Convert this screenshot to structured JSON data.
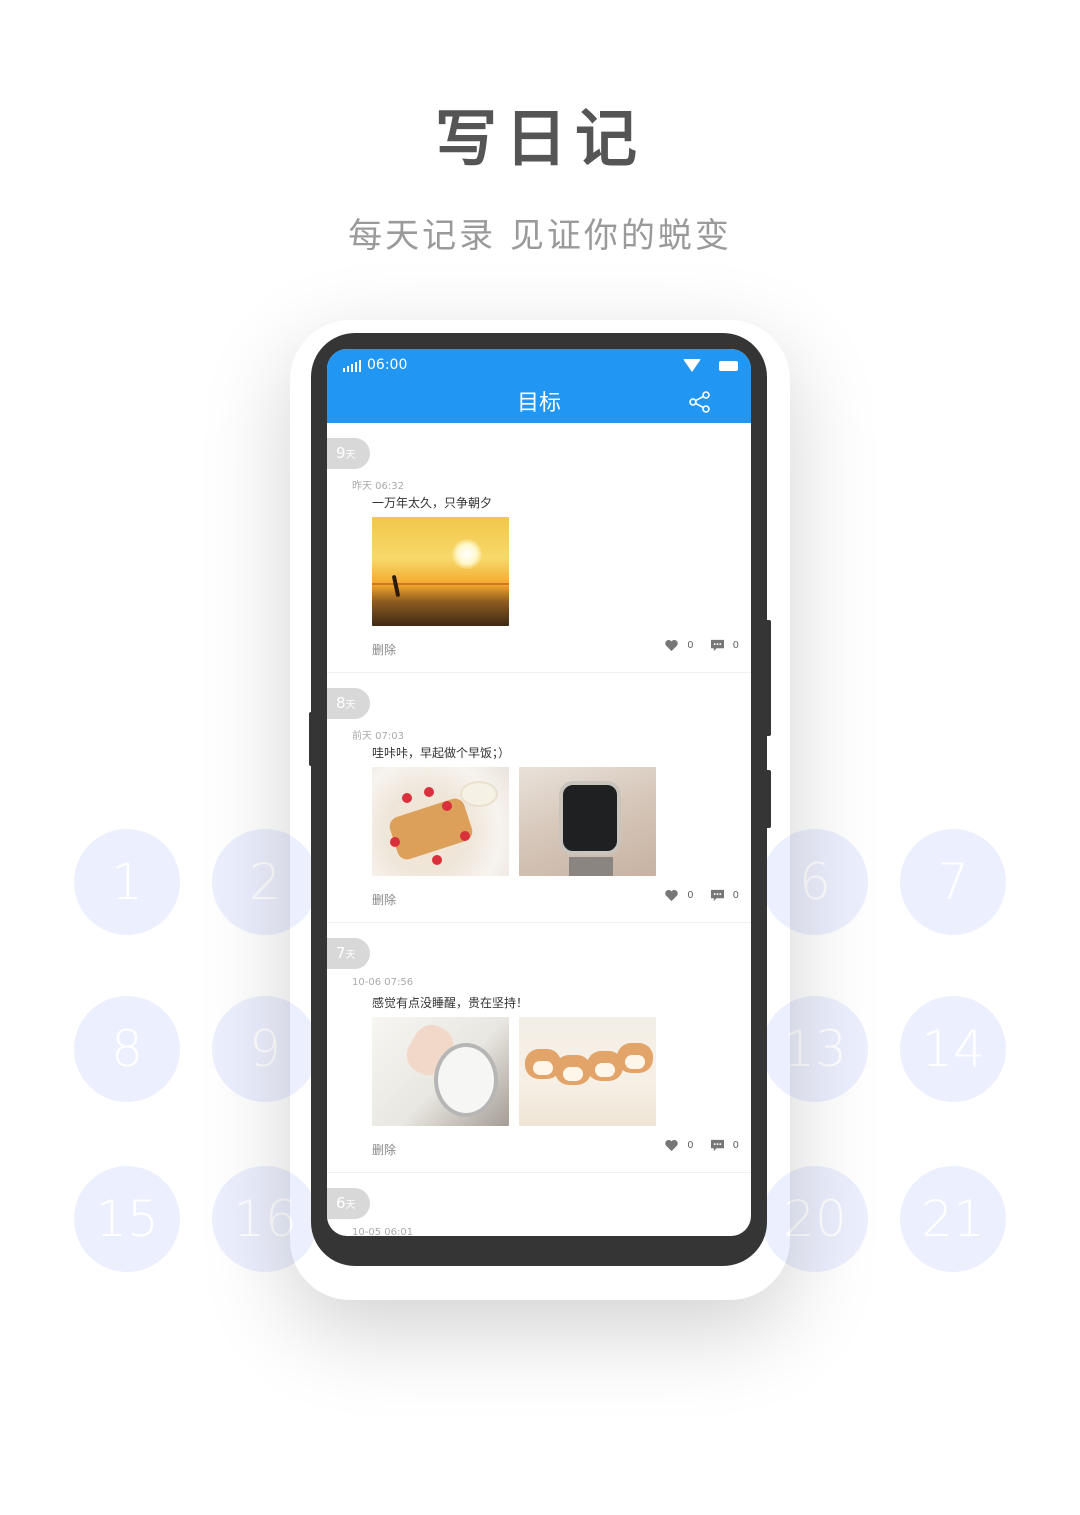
{
  "promo": {
    "headline": "写日记",
    "subline": "每天记录 见证你的蜕变"
  },
  "background_numbers": [
    "1",
    "2",
    "6",
    "7",
    "8",
    "9",
    "13",
    "14",
    "15",
    "16",
    "20",
    "21"
  ],
  "status_bar": {
    "time": "06:00"
  },
  "app_bar": {
    "title": "目标"
  },
  "entries": [
    {
      "day": "9",
      "unit": "天",
      "timestamp": "昨天 06:32",
      "text": "一万年太久，只争朝夕",
      "delete_label": "删除",
      "likes": "0",
      "comments": "0"
    },
    {
      "day": "8",
      "unit": "天",
      "timestamp": "前天 07:03",
      "text": "哇咔咔，早起做个早饭；）",
      "delete_label": "删除",
      "likes": "0",
      "comments": "0"
    },
    {
      "day": "7",
      "unit": "天",
      "timestamp": "10-06 07:56",
      "text": "感觉有点没睡醒，贵在坚持！",
      "delete_label": "删除",
      "likes": "0",
      "comments": "0"
    },
    {
      "day": "6",
      "unit": "天",
      "timestamp": "10-05 06:01"
    }
  ],
  "icons": {
    "share": "share-icon",
    "like": "heart-icon",
    "comment": "comment-icon",
    "signal": "signal-icon",
    "wifi": "wifi-icon",
    "battery": "battery-icon"
  },
  "colors": {
    "primary": "#2196f3",
    "phone_frame": "#353535",
    "badge": "#d8d8d8"
  }
}
